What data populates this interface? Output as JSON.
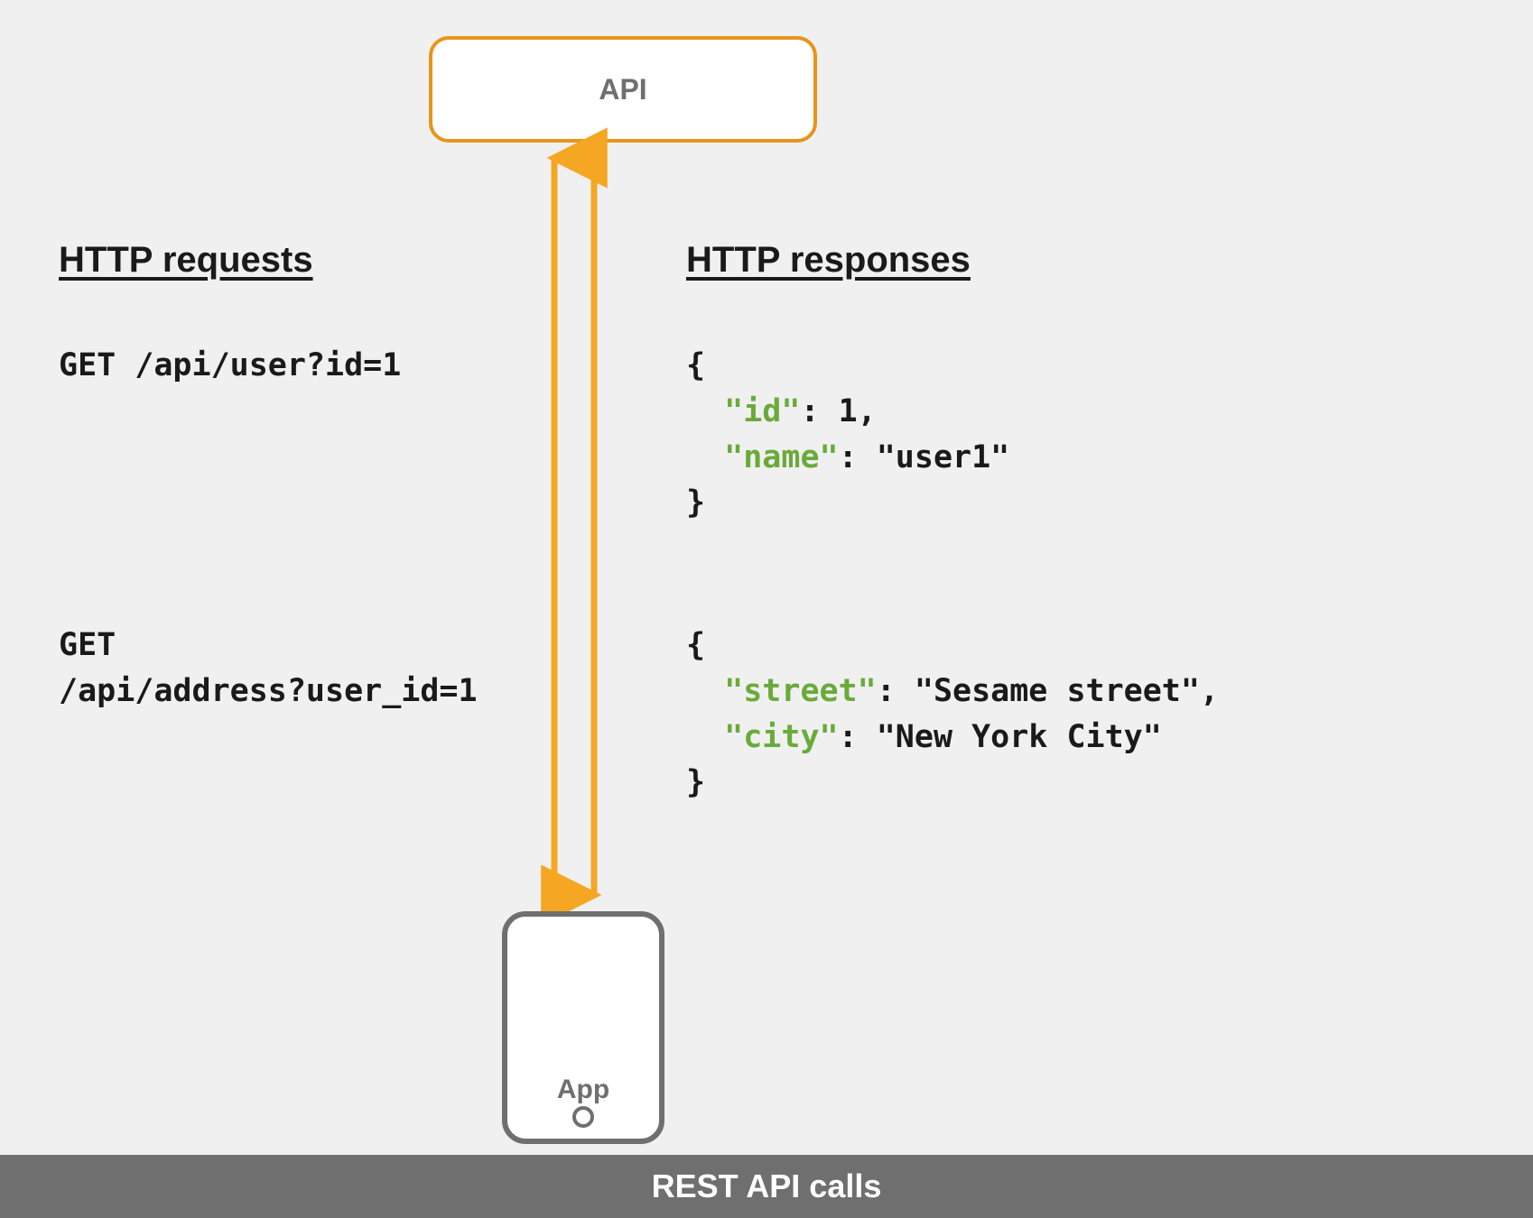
{
  "api_box_label": "API",
  "app_box_label": "App",
  "requests_heading": "HTTP requests",
  "responses_heading": "HTTP responses",
  "request1": "GET /api/user?id=1",
  "request2_line1": "GET",
  "request2_line2": "/api/address?user_id=1",
  "response1": {
    "open": "{",
    "line1_key": "\"id\"",
    "line1_rest": ": 1,",
    "line2_key": "\"name\"",
    "line2_rest": ": \"user1\"",
    "close": "}"
  },
  "response2": {
    "open": "{",
    "line1_key": "\"street\"",
    "line1_rest": ": \"Sesame street\",",
    "line2_key": "\"city\"",
    "line2_rest": ": \"New York City\"",
    "close": "}"
  },
  "footer": "REST API calls",
  "colors": {
    "accent_orange": "#e8941a",
    "json_key_green": "#6aaa3a",
    "box_gray": "#6f6f6f",
    "bg_light": "#f0f0f0"
  }
}
